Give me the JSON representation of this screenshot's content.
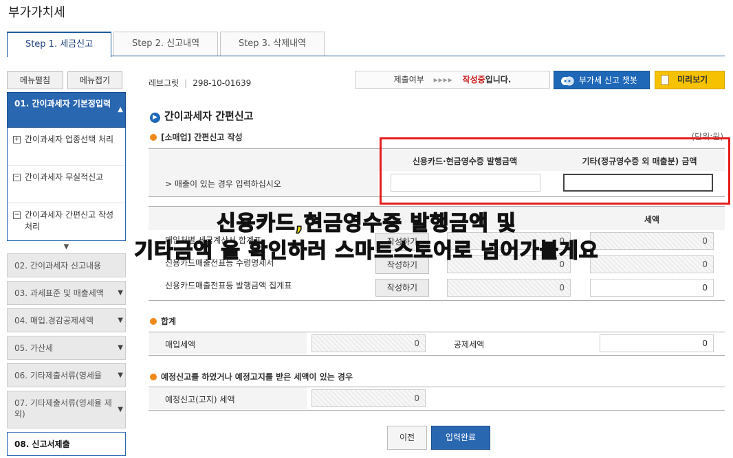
{
  "page_title": "부가가치세",
  "tabs": [
    "Step 1. 세금신고",
    "Step 2. 신고내역",
    "Step 3. 삭제내역"
  ],
  "sidebar": {
    "expand_label": "메뉴펼침",
    "collapse_label": "메뉴접기",
    "active_section": "01. 간이과세자 기본정입력",
    "sub_items": [
      {
        "icon": "+",
        "label": "간이과세자 업종선택 처리"
      },
      {
        "icon": "−",
        "label": "간이과세자 무실적신고"
      },
      {
        "icon": "−",
        "label": "간이과세자 간편신고 작성 처리"
      }
    ],
    "sections": [
      "02. 간이과세자 신고내용",
      "03. 과세표준 및 매출세액",
      "04. 매입.경감공제세액",
      "05. 가산세",
      "06. 기타제출서류(영세율",
      "07. 기타제출서류(영세율 제외)",
      "08. 신고서제출"
    ]
  },
  "business": {
    "name": "레브그릿",
    "number": "298-10-01639"
  },
  "status": {
    "label": "제출여부",
    "arrows": "▸▸▸▸",
    "state": "작성중",
    "state_suffix": "입니다."
  },
  "buttons": {
    "chatbot": "부가세 신고 챗봇",
    "preview": "미리보기",
    "prev": "이전",
    "complete": "입력완료"
  },
  "section_title": "간이과세자 간편신고",
  "sales": {
    "title": "[소매업] 간편신고 작성",
    "unit": "(단위:원)",
    "col_card": "신용카드·현금영수증 발행금액",
    "col_other": "기타(정규영수증 외 매출분) 금액",
    "row_label": "> 매출이 있는 경우 입력하십시오",
    "card_value": "",
    "other_value": ""
  },
  "purchase": {
    "col_tax": "세액",
    "write_label": "작성하기",
    "rows": [
      {
        "label": "매입처별 세금계산서 합계표",
        "amount": "0",
        "tax": "0"
      },
      {
        "label": "신용카드매출전표등 수령명세서",
        "amount": "0",
        "tax": "0"
      },
      {
        "label": "신용카드매출전표등 발행금액 집계표",
        "amount": "0",
        "tax": "0"
      }
    ]
  },
  "total": {
    "title": "합계",
    "purchase_label": "매입세액",
    "purchase_value": "0",
    "deduct_label": "공제세액",
    "deduct_value": "0"
  },
  "preliminary": {
    "title": "예정신고를 하였거나 예정고지를 받은 세액이 있는 경우",
    "label": "예정신고(고지) 세액",
    "value": "0"
  },
  "overlay": {
    "line1": "신용카드,현금영수증 발행금액 및",
    "line2": "기타금액 을 확인하러 스마트스토어로 넘어가볼게요"
  },
  "colors": {
    "brand_blue": "#2a67b1",
    "highlight_red": "#e51c1c",
    "overlay_yellow": "#f3ea00",
    "preview_yellow": "#f6c200",
    "status_red": "#c81919"
  }
}
